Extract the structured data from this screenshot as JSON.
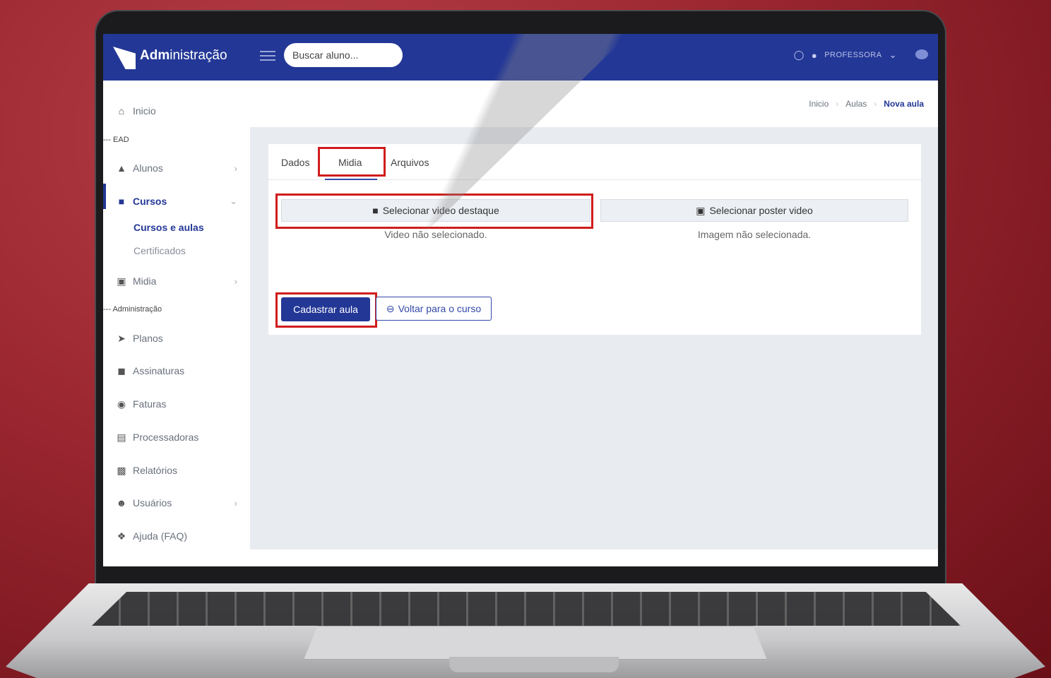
{
  "app": {
    "brand_bold": "Adm",
    "brand_rest": "inistração"
  },
  "topbar": {
    "search_placeholder": "Buscar aluno...",
    "user_label": "PROFESSORA"
  },
  "sidebar": {
    "home": "Inicio",
    "section_ead": "--- EAD",
    "alunos": "Alunos",
    "cursos": "Cursos",
    "cursos_sub": [
      "Cursos e aulas",
      "Certificados"
    ],
    "midia": "Midia",
    "section_admin": "--- Administração",
    "planos": "Planos",
    "assinaturas": "Assinaturas",
    "faturas": "Faturas",
    "processadoras": "Processadoras",
    "relatorios": "Relatórios",
    "usuarios": "Usuários",
    "ajuda": "Ajuda (FAQ)"
  },
  "breadcrumb": [
    "Inicio",
    "Aulas",
    "Nova aula"
  ],
  "tabs": [
    "Dados",
    "Midia",
    "Arquivos"
  ],
  "media": {
    "video_button": "Selecionar video destaque",
    "video_status": "Video não selecionado.",
    "poster_button": "Selecionar poster video",
    "poster_status": "Imagem não selecionada."
  },
  "actions": {
    "submit": "Cadastrar aula",
    "back": "Voltar para o curso"
  },
  "colors": {
    "primary": "#233796",
    "highlight": "#d01c1c"
  }
}
